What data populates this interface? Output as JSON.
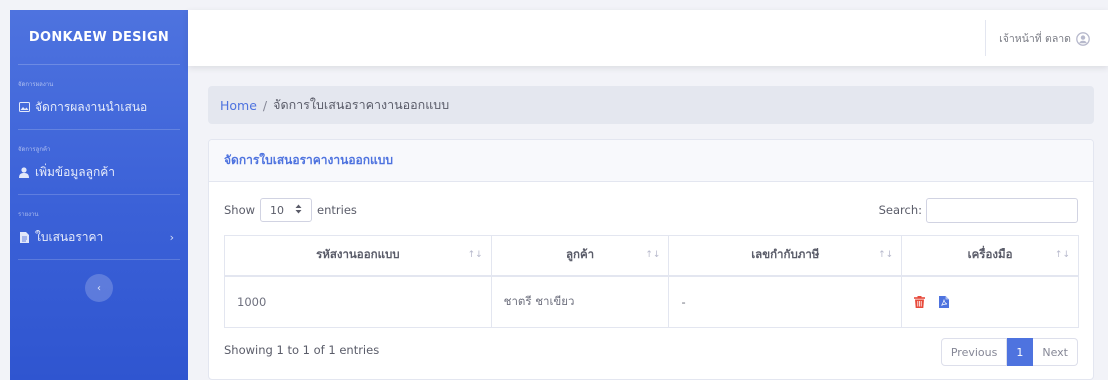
{
  "brand": "DONKAEW DESIGN",
  "sidebar": {
    "sections": [
      {
        "heading": "จัดการผลงาน",
        "item": "จัดการผลงานนำเสนอ",
        "icon": "image-icon"
      },
      {
        "heading": "จัดการลูกค้า",
        "item": "เพิ่มข้อมูลลูกค้า",
        "icon": "user-icon"
      },
      {
        "heading": "รายงาน",
        "item": "ใบเสนอราคา",
        "icon": "document-icon"
      }
    ],
    "chevron": "›",
    "toggle": "‹"
  },
  "topbar": {
    "user_name": "เจ้าหน้าที่ ตลาด",
    "user_icon": "user-circle-icon"
  },
  "breadcrumb": {
    "home": "Home",
    "separator": "/",
    "current": "จัดการใบเสนอราคางานออกแบบ"
  },
  "card": {
    "title": "จัดการใบเสนอราคางานออกแบบ",
    "length": {
      "show": "Show",
      "value": "10",
      "entries": "entries"
    },
    "search_label": "Search:",
    "search_value": "",
    "columns": [
      "รหัสงานออกแบบ",
      "ลูกค้า",
      "เลขกำกับภาษี",
      "เครื่องมือ"
    ],
    "rows": [
      {
        "code": "1000",
        "customer": "ชาตรี ชาเขียว",
        "tax_id": "-"
      }
    ],
    "info": "Showing 1 to 1 of 1 entries",
    "pager": {
      "previous": "Previous",
      "current": "1",
      "next": "Next"
    }
  },
  "colors": {
    "primary": "#4e73df",
    "danger": "#e74a3b",
    "page_bg": "#f2f3f8"
  }
}
